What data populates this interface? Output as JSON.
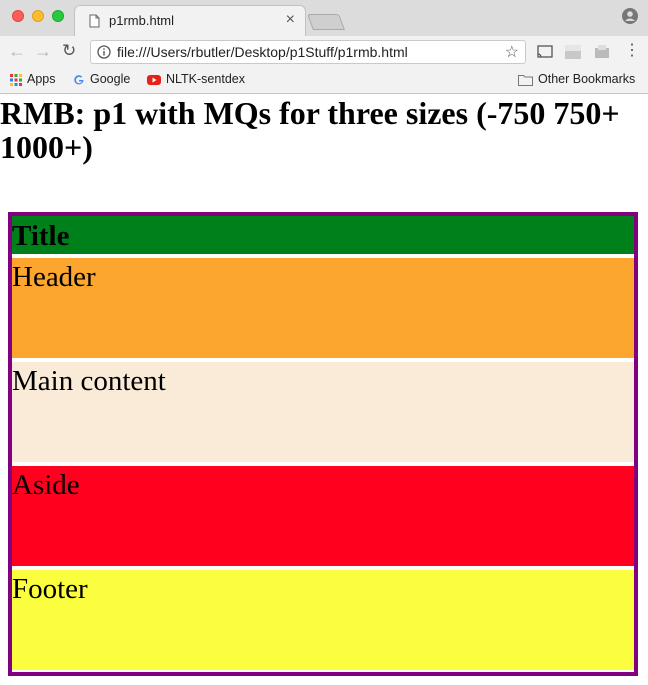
{
  "browser": {
    "tab_title": "p1rmb.html",
    "url": "file:///Users/rbutler/Desktop/p1Stuff/p1rmb.html",
    "bookmarks": [
      {
        "label": "Apps",
        "icon": "apps-grid-icon"
      },
      {
        "label": "Google",
        "icon": "google-icon"
      },
      {
        "label": "NLTK-sentdex",
        "icon": "youtube-icon"
      }
    ],
    "other_bookmarks": "Other Bookmarks"
  },
  "page": {
    "heading": "RMB: p1 with MQs for three sizes (-750 750+ 1000+)",
    "blocks": {
      "title": "Title",
      "header": "Header",
      "main": "Main content",
      "aside": "Aside",
      "footer": "Footer"
    }
  },
  "colors": {
    "container_border": "#800080",
    "title_bg": "#00801a",
    "header_bg": "#fca630",
    "main_bg": "#faebd8",
    "aside_bg": "#ff001f",
    "footer_bg": "#fbfe3f"
  }
}
